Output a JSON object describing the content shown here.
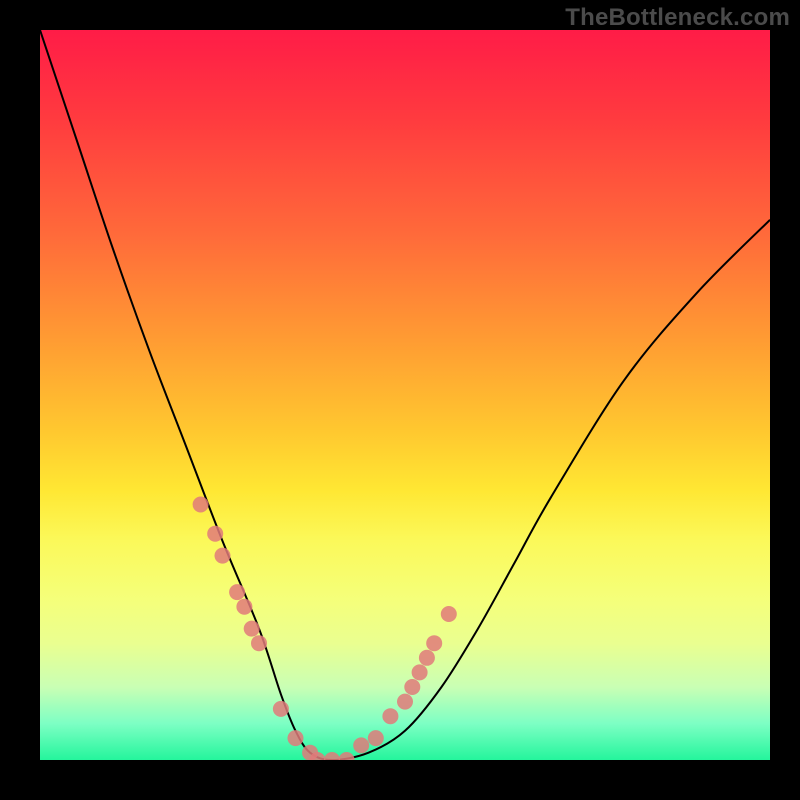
{
  "watermark": "TheBottleneck.com",
  "colors": {
    "frame_bg": "#000000",
    "watermark_text": "#4b4b4b",
    "marker": "#e07a7a",
    "curve": "#000000",
    "gradient_stops": [
      "#ff1c47",
      "#ff3a3f",
      "#ff6a3a",
      "#ff9a33",
      "#ffc82f",
      "#ffe733",
      "#fbf95a",
      "#f5ff7a",
      "#eaff90",
      "#c9ffb4",
      "#7dffc4",
      "#24f59c"
    ]
  },
  "chart_data": {
    "type": "line",
    "title": "",
    "xlabel": "",
    "ylabel": "",
    "xlim": [
      0,
      100
    ],
    "ylim": [
      0,
      100
    ],
    "grid": false,
    "legend": false,
    "series": [
      {
        "name": "v-curve",
        "x": [
          0,
          5,
          10,
          15,
          20,
          25,
          30,
          33,
          35,
          37,
          40,
          45,
          50,
          55,
          60,
          65,
          70,
          80,
          90,
          100
        ],
        "values": [
          100,
          85,
          70,
          56,
          43,
          30,
          18,
          9,
          4,
          1,
          0,
          1,
          4,
          10,
          18,
          27,
          36,
          52,
          64,
          74
        ]
      }
    ],
    "markers": {
      "name": "dots-on-curve",
      "x": [
        22,
        24,
        25,
        27,
        28,
        29,
        30,
        33,
        35,
        37,
        38,
        40,
        42,
        44,
        46,
        48,
        50,
        51,
        52,
        53,
        54,
        56
      ],
      "values": [
        35,
        31,
        28,
        23,
        21,
        18,
        16,
        7,
        3,
        1,
        0,
        0,
        0,
        2,
        3,
        6,
        8,
        10,
        12,
        14,
        16,
        20
      ]
    }
  }
}
